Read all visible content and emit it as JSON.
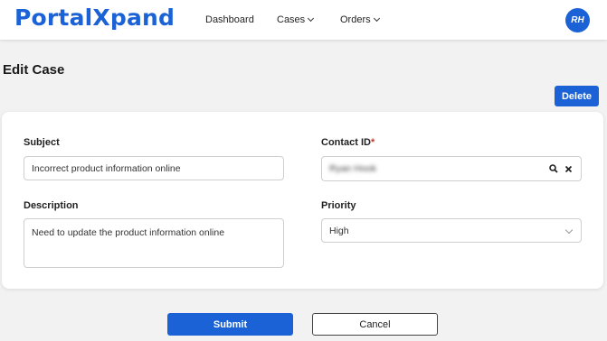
{
  "app": {
    "logo": "PortalXpand",
    "avatar_initials": "RH",
    "brand_color": "#1a62d6"
  },
  "nav": {
    "dashboard": "Dashboard",
    "cases": "Cases",
    "orders": "Orders"
  },
  "page": {
    "title": "Edit Case",
    "delete_label": "Delete"
  },
  "form": {
    "subject_label": "Subject",
    "subject_value": "Incorrect product information online",
    "contact_label": "Contact ID",
    "contact_required": "*",
    "contact_value": "Ryan Hook",
    "description_label": "Description",
    "description_value": "Need to update the product information online",
    "priority_label": "Priority",
    "priority_value": "High"
  },
  "actions": {
    "submit_label": "Submit",
    "cancel_label": "Cancel"
  }
}
